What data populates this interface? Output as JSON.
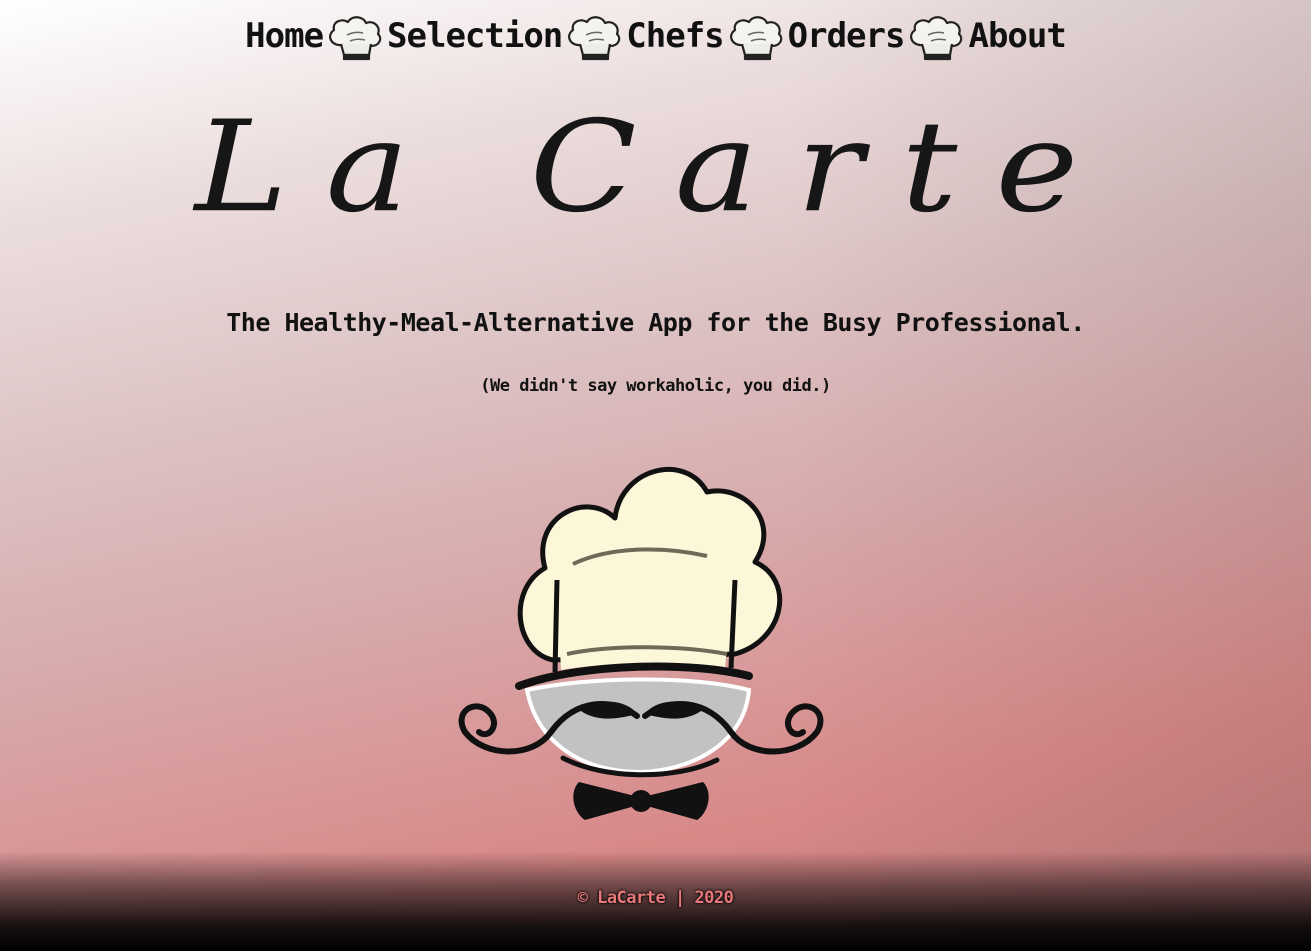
{
  "nav": {
    "items": [
      {
        "label": "Home"
      },
      {
        "label": "Selection"
      },
      {
        "label": "Chefs"
      },
      {
        "label": "Orders"
      },
      {
        "label": "About"
      }
    ],
    "separator_icon": "chef-hat-icon"
  },
  "brand": {
    "title": "La Carte"
  },
  "hero": {
    "tagline": "The Healthy-Meal-Alternative App for the Busy Professional.",
    "subtagline": "(We didn't say workaholic, you did.)",
    "illustration_icon": "chef-mascot-icon"
  },
  "footer": {
    "text": "© LaCarte | 2020"
  },
  "colors": {
    "footer_text": "#e8787a",
    "hat_fill": "#fdf7da",
    "face_fill": "#c2c2c2"
  }
}
